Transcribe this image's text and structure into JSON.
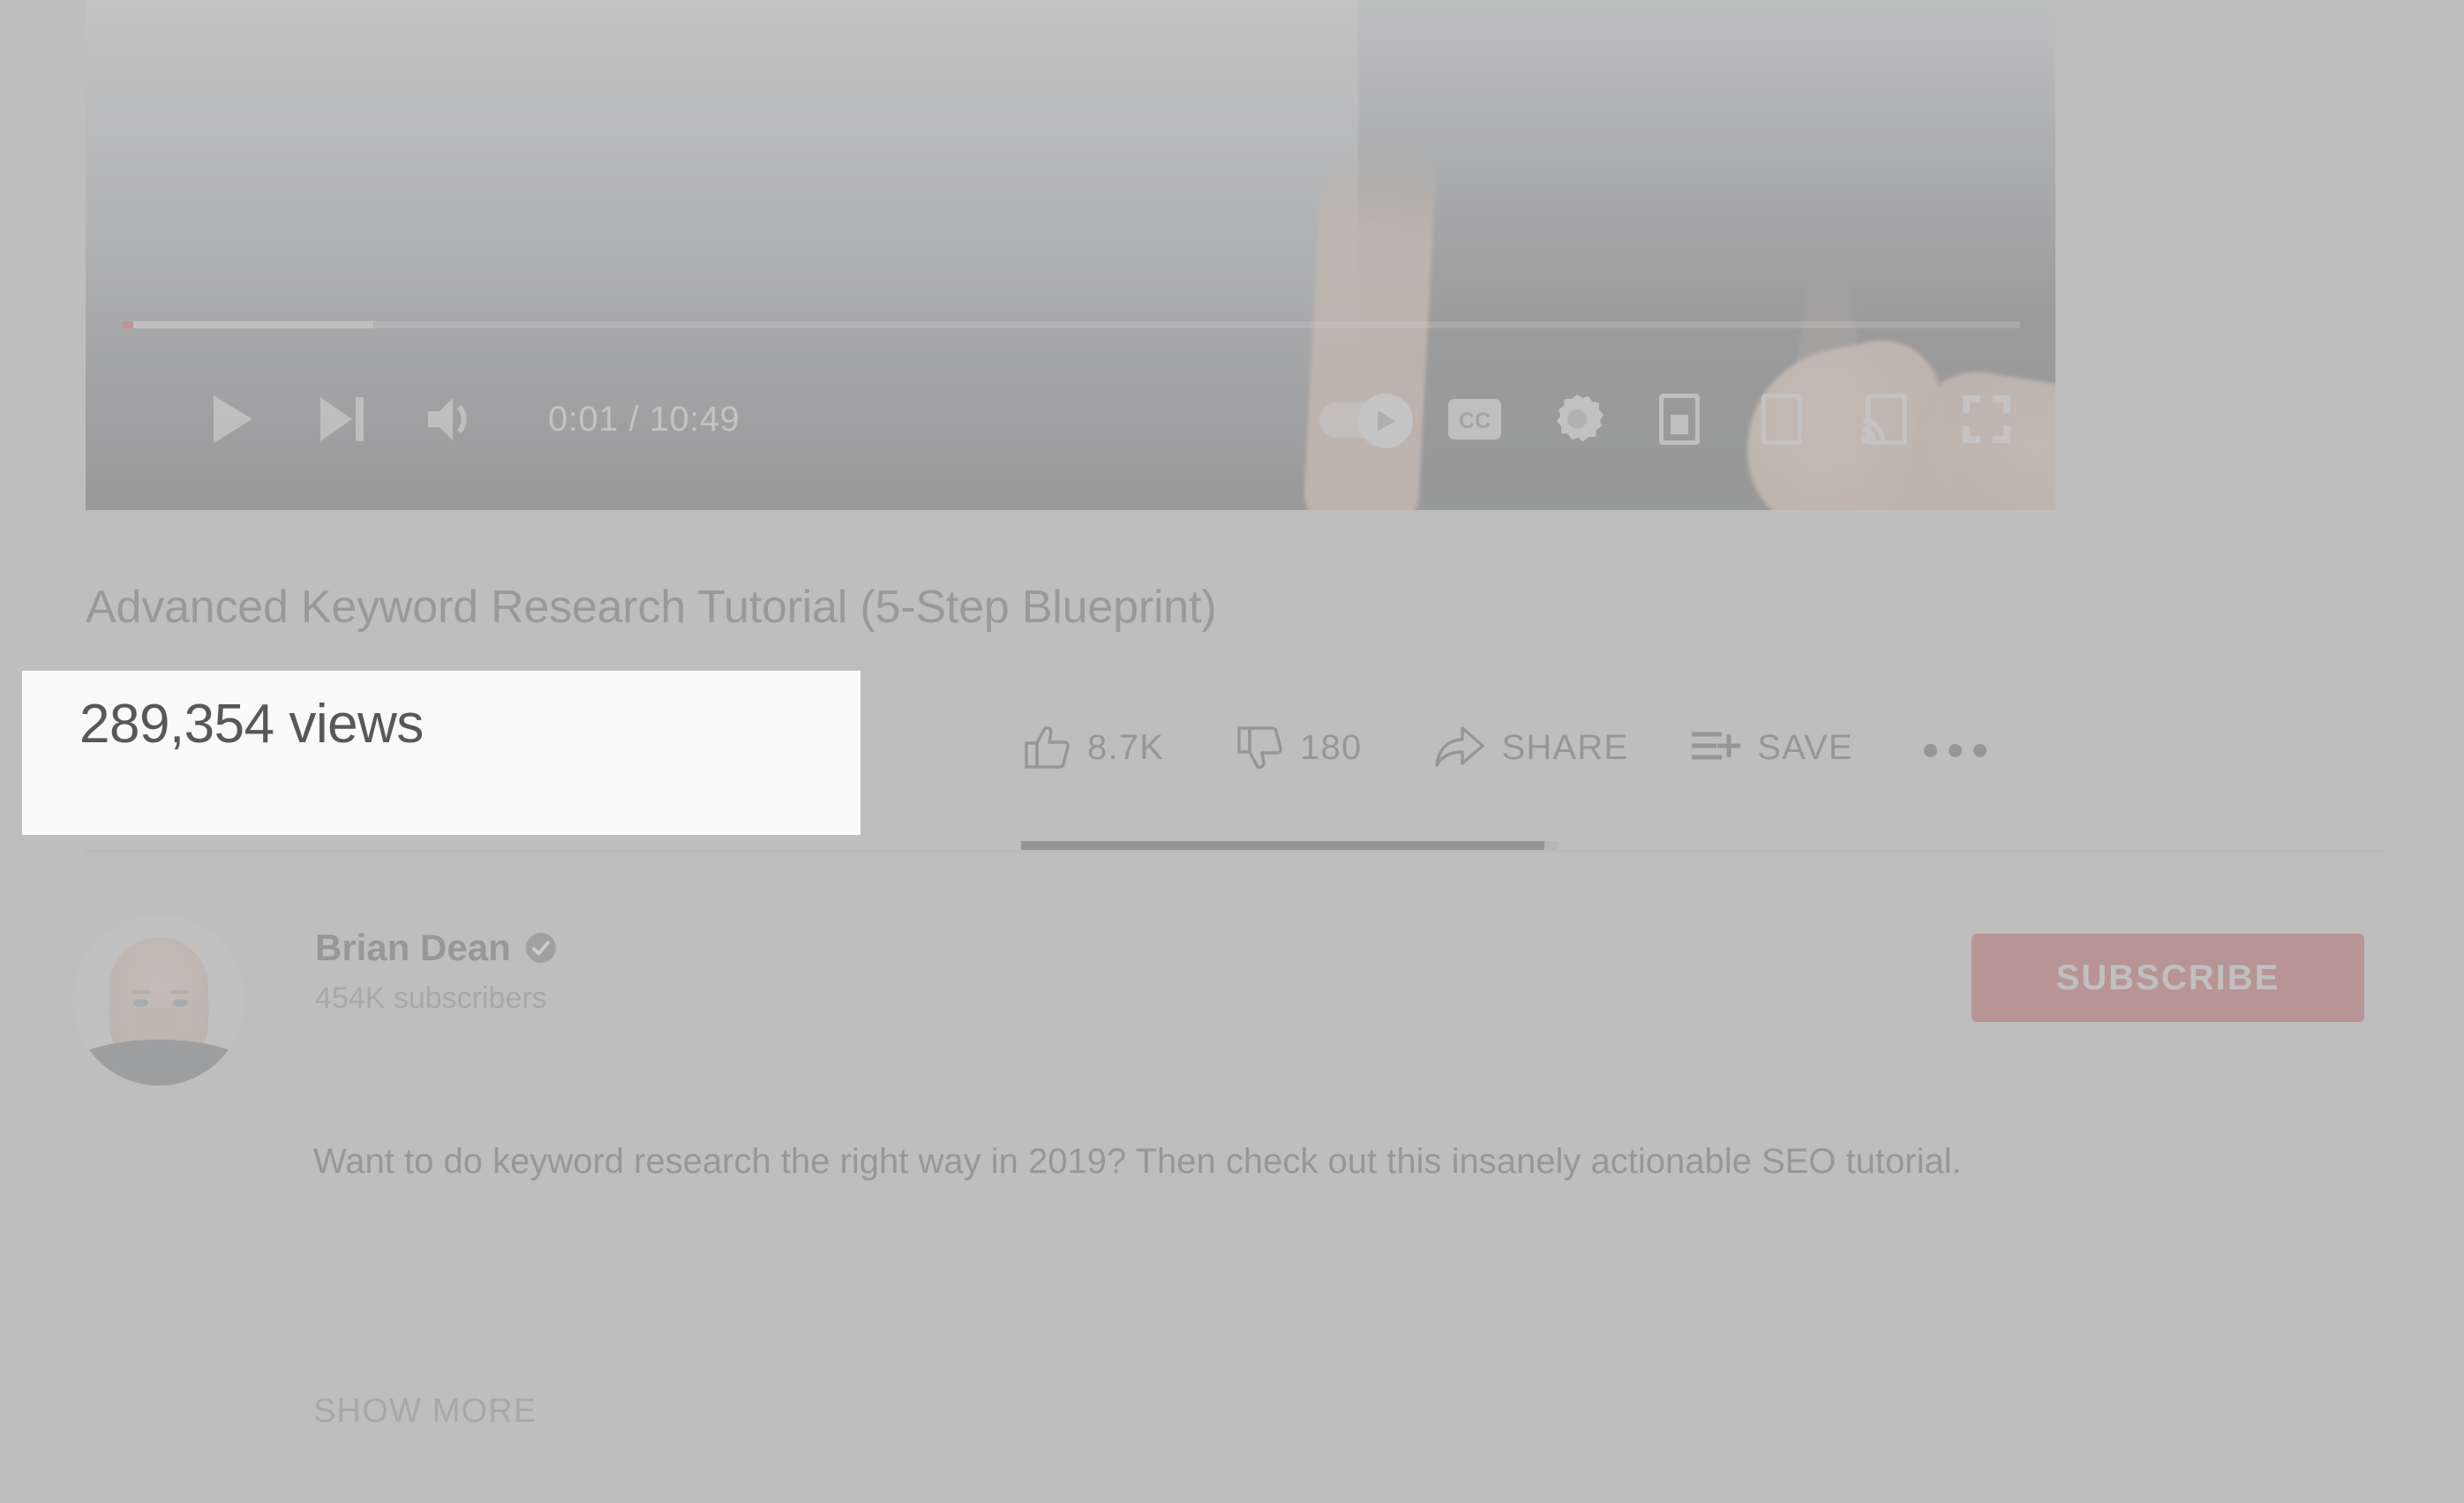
{
  "player": {
    "current_time": "0:01",
    "duration": "10:49",
    "time_display": "0:01 / 10:49",
    "progress_percent": 0.55,
    "buffered_percent": 13.2,
    "autoplay_on": true,
    "controls": {
      "play": "play-button",
      "next": "next-video-button",
      "volume": "volume-button",
      "autoplay": "autoplay-toggle",
      "captions": "closed-captions-button",
      "settings": "settings-gear-button",
      "miniplayer": "miniplayer-button",
      "theater": "theater-mode-button",
      "cast": "cast-button",
      "fullscreen": "fullscreen-button"
    },
    "accent_color": "#c00000"
  },
  "video": {
    "title": "Advanced Keyword Research Tutorial (5-Step Blueprint)",
    "views": "289,354 views"
  },
  "actions": {
    "like_count": "8.7K",
    "dislike_count": "180",
    "share_label": "SHARE",
    "save_label": "SAVE",
    "more_label": "more-actions"
  },
  "channel": {
    "name": "Brian Dean",
    "verified": true,
    "subscribers": "454K subscribers",
    "subscribe_label": "SUBSCRIBE",
    "subscribe_color": "#a40000"
  },
  "description": {
    "text": "Want to do keyword research the right way in 2019? Then check out this insanely actionable SEO tutorial.",
    "show_more_label": "SHOW MORE"
  },
  "highlight": {
    "text": "289,354 views",
    "background": "#fafafa"
  }
}
